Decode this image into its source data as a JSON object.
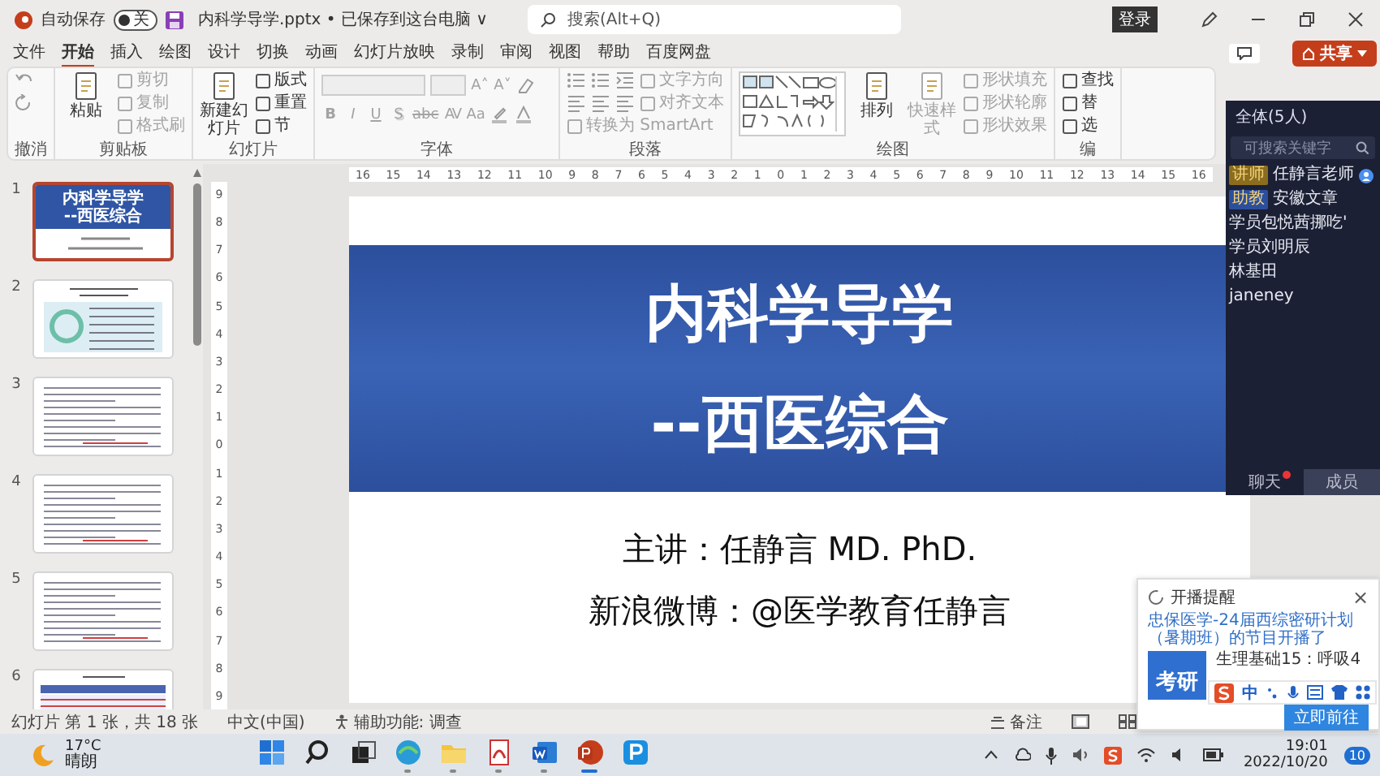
{
  "title_bar": {
    "autosave": {
      "label": "自动保存",
      "on": false,
      "state_text": "关"
    },
    "document_title": "内科学导学.pptx • 已保存到这台电脑 ∨",
    "search": {
      "placeholder": "搜索(Alt+Q)"
    },
    "sign_in": "登录"
  },
  "tabs": [
    {
      "label": "文件",
      "selected": false
    },
    {
      "label": "开始",
      "selected": true
    },
    {
      "label": "插入",
      "selected": false
    },
    {
      "label": "绘图",
      "selected": false
    },
    {
      "label": "设计",
      "selected": false
    },
    {
      "label": "切换",
      "selected": false
    },
    {
      "label": "动画",
      "selected": false
    },
    {
      "label": "幻灯片放映",
      "selected": false
    },
    {
      "label": "录制",
      "selected": false
    },
    {
      "label": "审阅",
      "selected": false
    },
    {
      "label": "视图",
      "selected": false
    },
    {
      "label": "帮助",
      "selected": false
    },
    {
      "label": "百度网盘",
      "selected": false
    }
  ],
  "share_button": "共享",
  "ribbon": {
    "groups": [
      {
        "label": "撤消",
        "columns": [
          [
            {
              "kind": "undo"
            },
            {
              "kind": "redo"
            }
          ]
        ]
      },
      {
        "label": "剪贴板",
        "columns": [
          [
            {
              "kind": "large",
              "label": "粘贴",
              "disabled": false
            }
          ],
          [
            {
              "kind": "small",
              "label": "剪切",
              "disabled": true
            },
            {
              "kind": "small",
              "label": "复制",
              "disabled": true
            },
            {
              "kind": "small",
              "label": "格式刷",
              "disabled": true
            }
          ]
        ]
      },
      {
        "label": "幻灯片",
        "columns": [
          [
            {
              "kind": "large",
              "label": "新建幻灯片",
              "disabled": false
            }
          ],
          [
            {
              "kind": "small",
              "label": "版式",
              "disabled": false
            },
            {
              "kind": "small",
              "label": "重置",
              "disabled": false
            },
            {
              "kind": "small",
              "label": "节",
              "disabled": false
            }
          ]
        ]
      },
      {
        "label": "字体",
        "items": [
          {
            "kind": "font-field"
          },
          {
            "kind": "size-field"
          },
          {
            "kind": "grow",
            "label": "A˄",
            "disabled": true
          },
          {
            "kind": "shrink",
            "label": "A˅",
            "disabled": true
          },
          {
            "kind": "clear"
          },
          {
            "kind": "bold",
            "label": "B",
            "disabled": true
          },
          {
            "kind": "italic",
            "label": "I",
            "disabled": true
          },
          {
            "kind": "underline",
            "label": "U",
            "disabled": true
          },
          {
            "kind": "shadow",
            "label": "S",
            "disabled": true
          },
          {
            "kind": "strike",
            "label": "abc",
            "disabled": true
          },
          {
            "kind": "spacing",
            "label": "AV",
            "disabled": true
          },
          {
            "kind": "case",
            "label": "Aa",
            "disabled": true
          },
          {
            "kind": "highlight"
          },
          {
            "kind": "font-color"
          }
        ]
      },
      {
        "label": "段落",
        "rows": [
          [
            {
              "kind": "list"
            },
            {
              "kind": "list"
            },
            {
              "kind": "indent"
            },
            {
              "kind": "small",
              "label": "文字方向",
              "disabled": true
            }
          ],
          [
            {
              "kind": "align"
            },
            {
              "kind": "align"
            },
            {
              "kind": "align"
            },
            {
              "kind": "small",
              "label": "对齐文本",
              "disabled": true
            }
          ],
          [
            {
              "kind": "small",
              "label": "转换为 SmartArt",
              "disabled": true
            }
          ]
        ]
      },
      {
        "label": "绘图",
        "columns": [
          [
            {
              "kind": "gallery"
            }
          ],
          [
            {
              "kind": "large",
              "label": "排列",
              "disabled": false
            }
          ],
          [
            {
              "kind": "large",
              "label": "快速样式",
              "disabled": true
            }
          ],
          [
            {
              "kind": "small",
              "label": "形状填充",
              "disabled": true
            },
            {
              "kind": "small",
              "label": "形状轮廓",
              "disabled": true
            },
            {
              "kind": "small",
              "label": "形状效果",
              "disabled": true
            }
          ]
        ]
      },
      {
        "label": "编",
        "columns": [
          [
            {
              "kind": "small",
              "label": "查找",
              "disabled": false
            },
            {
              "kind": "small",
              "label": "替",
              "disabled": false
            },
            {
              "kind": "small",
              "label": "选",
              "disabled": false
            }
          ]
        ]
      }
    ]
  },
  "slides": [
    {
      "number": "1",
      "selected": true,
      "kind": "title",
      "title_lines": [
        "内科学导学",
        "--西医综合"
      ]
    },
    {
      "number": "2",
      "selected": false,
      "kind": "chart"
    },
    {
      "number": "3",
      "selected": false,
      "kind": "text"
    },
    {
      "number": "4",
      "selected": false,
      "kind": "text"
    },
    {
      "number": "5",
      "selected": false,
      "kind": "text"
    },
    {
      "number": "6",
      "selected": false,
      "kind": "table"
    }
  ],
  "horizontal_ruler": [
    "16",
    "15",
    "14",
    "13",
    "12",
    "11",
    "10",
    "9",
    "8",
    "7",
    "6",
    "5",
    "4",
    "3",
    "2",
    "1",
    "0",
    "1",
    "2",
    "3",
    "4",
    "5",
    "6",
    "7",
    "8",
    "9",
    "10",
    "11",
    "12",
    "13",
    "14",
    "15",
    "16"
  ],
  "vertical_ruler": [
    "9",
    "8",
    "7",
    "6",
    "5",
    "4",
    "3",
    "2",
    "1",
    "0",
    "1",
    "2",
    "3",
    "4",
    "5",
    "6",
    "7",
    "8",
    "9"
  ],
  "slide": {
    "title": "内科学导学",
    "subtitle": "--西医综合",
    "lines": [
      "主讲：任静言 MD. PhD.",
      "新浪微博：@医学教育任静言"
    ]
  },
  "chat": {
    "header": "全体(5人)",
    "search": {
      "placeholder": "可搜索关键字"
    },
    "members": [
      {
        "role": "讲师",
        "color": "#8a6d1e",
        "name": "任静言老师",
        "badge": true
      },
      {
        "role": "助教",
        "color": "#2c4f9c",
        "name": "安徽文章",
        "badge": false
      },
      {
        "name": "学员包悦茜挪吃'",
        "badge": false
      },
      {
        "name": "学员刘明辰",
        "badge": false
      },
      {
        "name": "林基田",
        "badge": false
      },
      {
        "name": "janeney",
        "badge": false
      }
    ],
    "tabs": [
      {
        "label": "聊天",
        "selected": false,
        "unread": true
      },
      {
        "label": "成员",
        "selected": true,
        "unread": false
      }
    ]
  },
  "popup": {
    "title": "开播提醒",
    "close": "×",
    "message": "忠保医学-24届西综密研计划（暑期班）的节目开播了",
    "thumbnail_text": "考研",
    "course": "生理基础15：呼吸4",
    "button": "立即前往"
  },
  "ime": {
    "mode": "中"
  },
  "status_bar": {
    "slide_info": "幻灯片 第 1 张，共 18 张",
    "language": "中文(中国)",
    "accessibility": "辅助功能: 调查",
    "notes": "备注"
  },
  "taskbar": {
    "weather": {
      "temp": "17°C",
      "text": "晴朗"
    },
    "apps": [
      {
        "kind": "start",
        "running": false,
        "selected": false
      },
      {
        "kind": "search",
        "running": false,
        "selected": false
      },
      {
        "kind": "taskview",
        "running": false,
        "selected": false
      },
      {
        "kind": "browser",
        "running": true,
        "selected": false
      },
      {
        "kind": "folder",
        "running": true,
        "selected": false
      },
      {
        "kind": "pdf",
        "running": true,
        "selected": false
      },
      {
        "kind": "word",
        "running": true,
        "selected": false
      },
      {
        "kind": "ppt",
        "running": true,
        "selected": true
      },
      {
        "kind": "p",
        "running": false,
        "selected": false
      }
    ],
    "time": "19:01",
    "date": "2022/10/20",
    "notifications": "10"
  }
}
